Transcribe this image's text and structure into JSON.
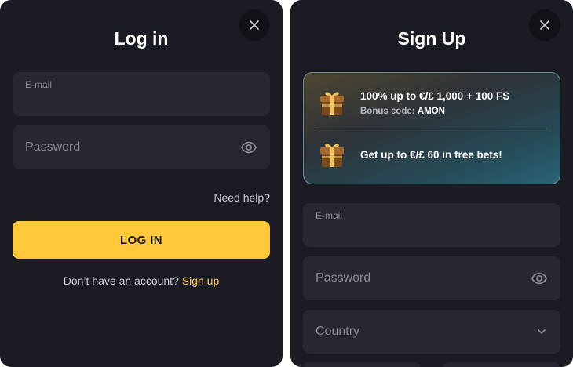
{
  "login": {
    "title": "Log in",
    "email_label": "E-mail",
    "password_placeholder": "Password",
    "need_help": "Need help?",
    "login_button": "LOG IN",
    "no_account_text": "Don’t have an account?",
    "signup_link": "Sign up"
  },
  "signup": {
    "title": "Sign Up",
    "bonuses": [
      {
        "title": "100% up to €/£ 1,000 + 100 FS",
        "code_label": "Bonus code:",
        "code": "AMON"
      },
      {
        "title": "Get up to €/£ 60 in free bets!"
      }
    ],
    "email_label": "E-mail",
    "password_placeholder": "Password",
    "country_placeholder": "Country"
  },
  "icons": {
    "close": "close-icon",
    "eye": "eye-icon",
    "chevron": "chevron-down-icon",
    "gift": "gift-icon"
  },
  "colors": {
    "panel_bg": "#1b1c23",
    "field_bg": "#262730",
    "accent": "#ffc83a",
    "muted_text": "#8a8b95"
  }
}
